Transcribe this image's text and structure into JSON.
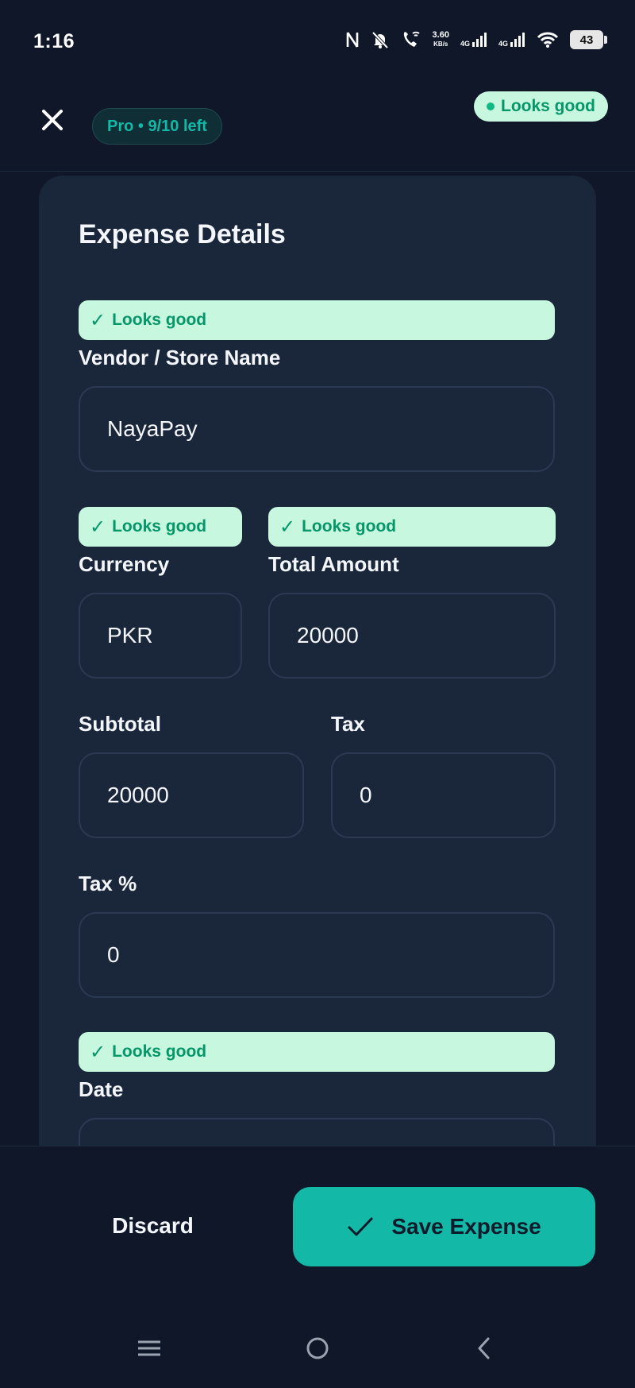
{
  "status_bar": {
    "time": "1:16",
    "net_speed_value": "3.60",
    "net_speed_unit": "KB/s",
    "sim1": "4G",
    "sim2": "4G",
    "battery": "43"
  },
  "header": {
    "plan_badge": "Pro • 9/10 left",
    "overall_status": "Looks good"
  },
  "card": {
    "title": "Expense Details",
    "validation_text": "Looks good",
    "fields": {
      "vendor": {
        "label": "Vendor / Store Name",
        "value": "NayaPay"
      },
      "currency": {
        "label": "Currency",
        "value": "PKR"
      },
      "total_amount": {
        "label": "Total Amount",
        "value": "20000"
      },
      "subtotal": {
        "label": "Subtotal",
        "value": "20000"
      },
      "tax": {
        "label": "Tax",
        "value": "0"
      },
      "tax_percent": {
        "label": "Tax %",
        "value": "0"
      },
      "date": {
        "label": "Date",
        "value": ""
      }
    }
  },
  "footer": {
    "discard_label": "Discard",
    "save_label": "Save Expense"
  },
  "colors": {
    "background": "#0f1729",
    "card": "#1a2639",
    "accent": "#14b8a6",
    "success_bg": "#c7f7de",
    "success_text": "#059669"
  },
  "icons": {
    "close": "close-icon",
    "check": "check-icon",
    "nav_menu": "menu-icon",
    "nav_home": "home-icon",
    "nav_back": "back-icon"
  }
}
